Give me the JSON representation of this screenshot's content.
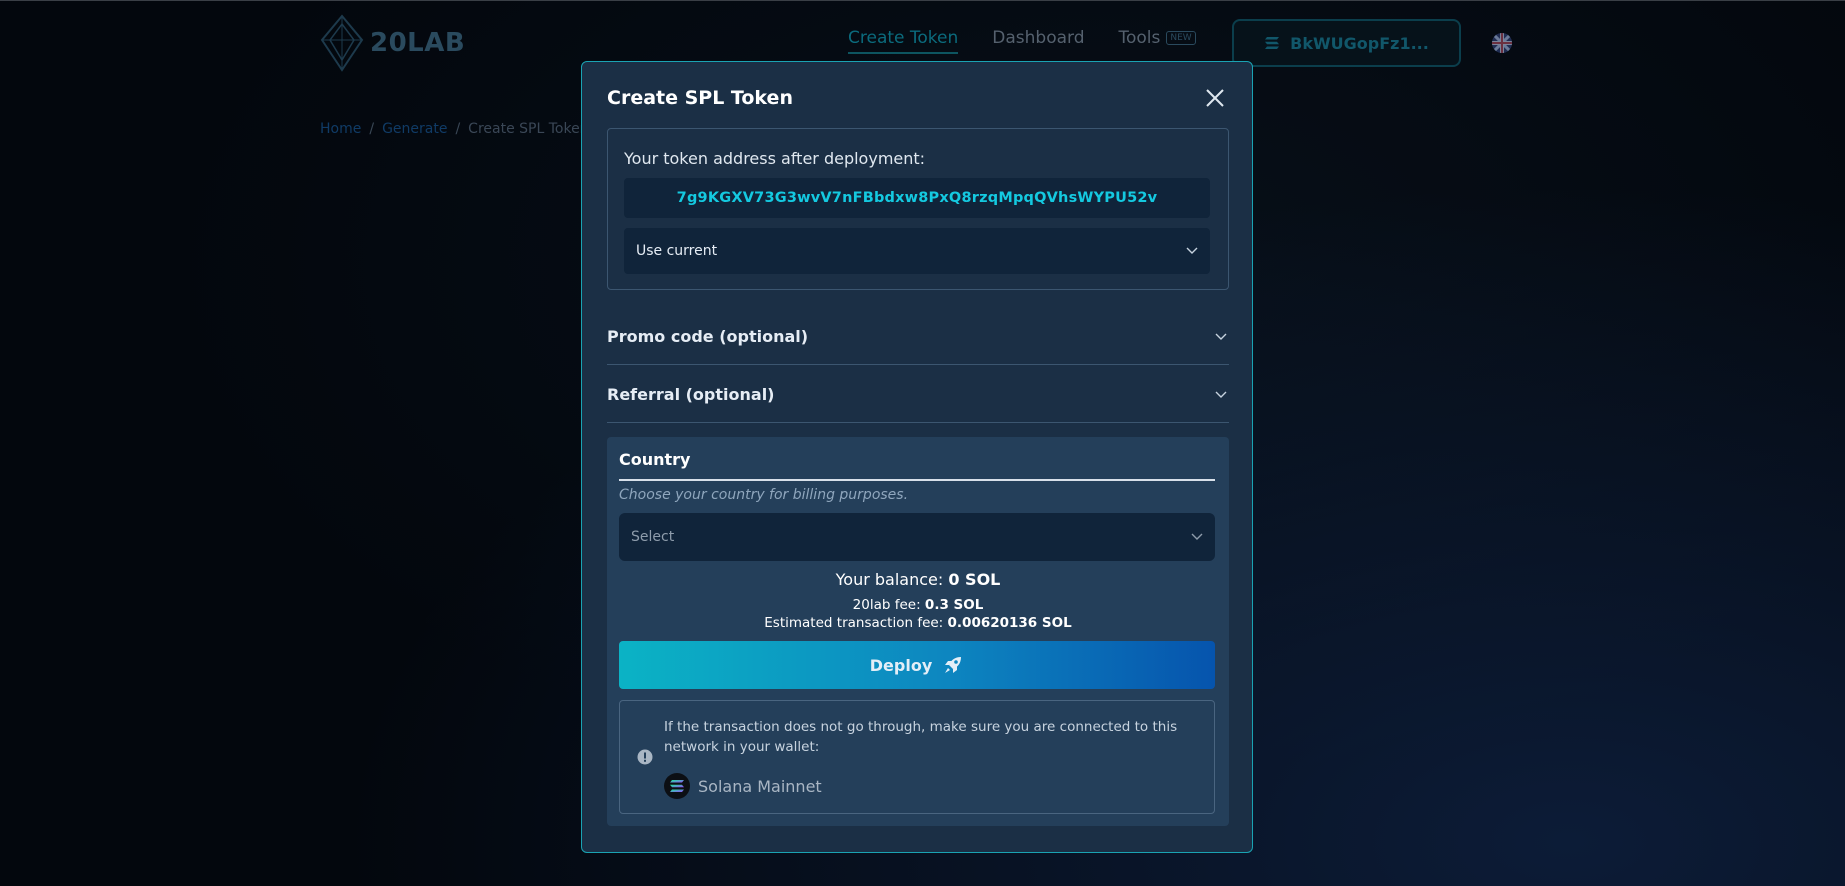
{
  "header": {
    "logo_text": "20LAB",
    "nav": [
      {
        "label": "Create Token",
        "active": true
      },
      {
        "label": "Dashboard",
        "active": false
      },
      {
        "label": "Tools",
        "active": false,
        "badge": "NEW"
      }
    ],
    "wallet_label": "BkWUGopFz1..."
  },
  "breadcrumb": [
    "Home",
    "Generate",
    "Create SPL Token"
  ],
  "modal": {
    "title": "Create SPL Token",
    "address_label": "Your token address after deployment:",
    "address_value": "7g9KGXV73G3wvV7nFBbdxw8PxQ8rzqMpqQVhsWYPU52v",
    "address_mode": "Use current",
    "promo_label": "Promo code (optional)",
    "referral_label": "Referral (optional)",
    "country": {
      "title": "Country",
      "hint": "Choose your country for billing purposes.",
      "placeholder": "Select"
    },
    "balance_label": "Your balance: ",
    "balance_value": "0 SOL",
    "fee_label": "20lab fee: ",
    "fee_value": "0.3 SOL",
    "tx_fee_label": "Estimated transaction fee: ",
    "tx_fee_value": "0.00620136 SOL",
    "deploy_label": "Deploy",
    "info_text": "If the transaction does not go through, make sure you are connected to this network in your wallet:",
    "network_name": "Solana Mainnet"
  },
  "colors": {
    "accent": "#14c9e0",
    "modal_bg": "#1b2f45",
    "modal_border": "#1aa3b3",
    "deploy_start": "#0bb3c5",
    "deploy_end": "#0654ad"
  }
}
